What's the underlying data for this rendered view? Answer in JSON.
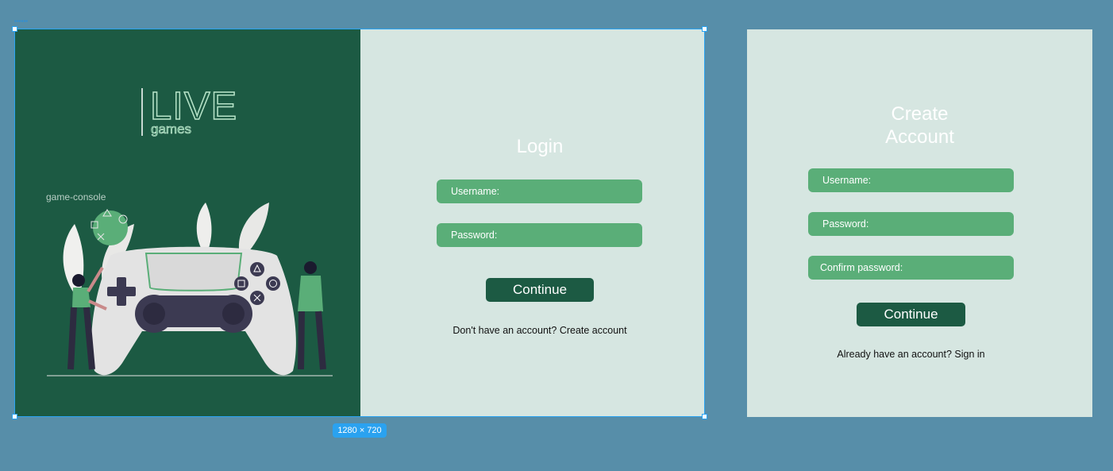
{
  "frame": {
    "size_badge": "1280 × 720"
  },
  "branding": {
    "logo_main": "LIVE",
    "logo_sub": "games",
    "illustration_label": "game-console"
  },
  "login": {
    "title": "Login",
    "username_placeholder": "Username:",
    "password_placeholder": "Password:",
    "continue_label": "Continue",
    "footer_text": "Don't have an account? Create account"
  },
  "create_account": {
    "title_line1": "Create",
    "title_line2": "Account",
    "username_placeholder": "Username:",
    "password_placeholder": "Password:",
    "confirm_password_placeholder": "Confirm password:",
    "continue_label": "Continue",
    "footer_text": "Already have an account? Sign in"
  },
  "colors": {
    "canvas": "#578ea9",
    "brand_dark": "#1c5a43",
    "panel_light": "#d6e6e1",
    "field_green": "#5aae78",
    "selection": "#29a3f2"
  }
}
